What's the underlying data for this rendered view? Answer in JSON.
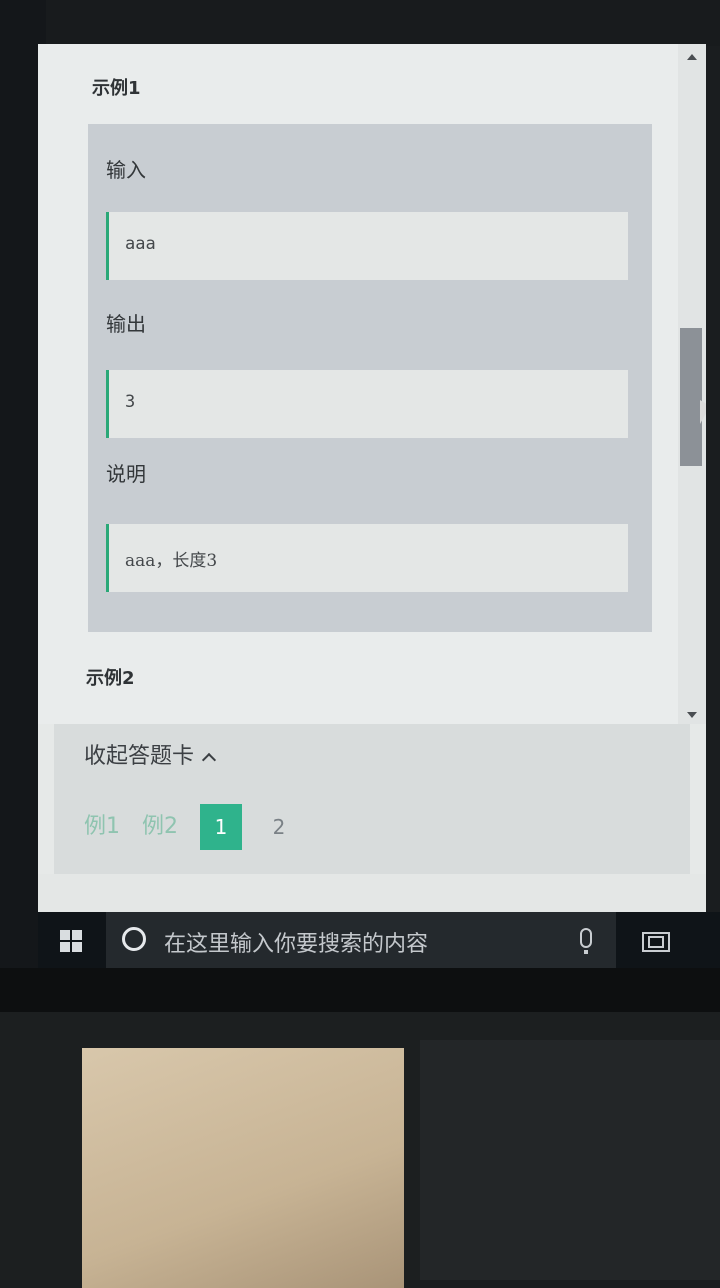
{
  "problem": {
    "examples": [
      {
        "title": "示例1",
        "input_label": "输入",
        "input_value": "aaa",
        "output_label": "输出",
        "output_value": "3",
        "explain_label": "说明",
        "explain_value": "aaa，长度3"
      },
      {
        "title": "示例2"
      }
    ]
  },
  "answer_card": {
    "toggle_label": "收起答题卡",
    "items": [
      "例1",
      "例2",
      "1",
      "2"
    ],
    "active_index": 2
  },
  "taskbar": {
    "search_placeholder": "在这里输入你要搜索的内容"
  },
  "colors": {
    "accent": "#2fb38c",
    "code_border": "#2aa878",
    "taskbar": "#0f1418"
  }
}
